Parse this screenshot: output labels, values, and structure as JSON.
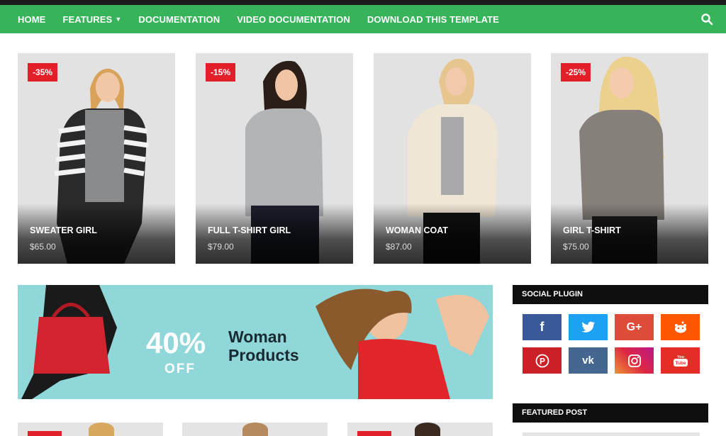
{
  "nav": {
    "items": [
      {
        "label": "HOME"
      },
      {
        "label": "FEATURES",
        "has_dropdown": true
      },
      {
        "label": "DOCUMENTATION"
      },
      {
        "label": "VIDEO DOCUMENTATION"
      },
      {
        "label": "DOWNLOAD THIS TEMPLATE"
      }
    ],
    "search_icon": "search-icon"
  },
  "colors": {
    "nav_bg": "#37b35a",
    "top_bar": "#1c1c1c",
    "badge": "#e32029",
    "widget_head": "#0f0f0f"
  },
  "products": [
    {
      "badge": "-35%",
      "title": "SWEATER GIRL",
      "price": "$65.00"
    },
    {
      "badge": "-15%",
      "title": "FULL T-SHIRT GIRL",
      "price": "$79.00"
    },
    {
      "badge": "",
      "title": "WOMAN COAT",
      "price": "$87.00"
    },
    {
      "badge": "-25%",
      "title": "GIRL T-SHIRT",
      "price": "$75.00"
    }
  ],
  "banner": {
    "percent": "40%",
    "off": "OFF",
    "title": "Woman Products"
  },
  "social": {
    "heading": "SOCIAL PLUGIN",
    "buttons": [
      {
        "icon": "facebook-icon",
        "glyph": "f",
        "color": "#3b5998"
      },
      {
        "icon": "twitter-icon",
        "glyph": "🐦",
        "color": "#1da1f2"
      },
      {
        "icon": "google-plus-icon",
        "glyph": "G+",
        "color": "#dd4b39"
      },
      {
        "icon": "reddit-icon",
        "glyph": "●",
        "color": "#ff5700"
      },
      {
        "icon": "pinterest-icon",
        "glyph": "P",
        "color": "#cb2027"
      },
      {
        "icon": "vk-icon",
        "glyph": "vk",
        "color": "#45668e"
      },
      {
        "icon": "instagram-icon",
        "glyph": "◎",
        "color": "#c13584"
      },
      {
        "icon": "youtube-icon",
        "glyph": "▶",
        "color": "#e52d27"
      }
    ]
  },
  "featured": {
    "heading": "FEATURED POST"
  }
}
